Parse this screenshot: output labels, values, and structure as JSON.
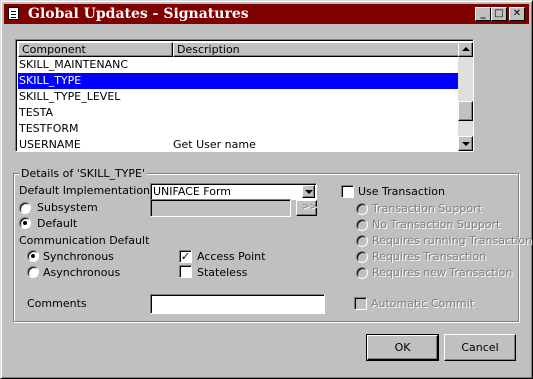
{
  "window": {
    "title": "Global Updates - Signatures",
    "minimize": "_",
    "maximize": "□",
    "close": "✕"
  },
  "list": {
    "columns": [
      "Component",
      "Description"
    ],
    "rows": [
      {
        "component": "SKILL_MAINTENANC",
        "description": ""
      },
      {
        "component": "SKILL_TYPE",
        "description": "",
        "selected": true
      },
      {
        "component": "SKILL_TYPE_LEVEL",
        "description": ""
      },
      {
        "component": "TESTA",
        "description": ""
      },
      {
        "component": "TESTFORM",
        "description": ""
      },
      {
        "component": "USERNAME",
        "description": "Get User name"
      }
    ]
  },
  "details": {
    "group_label": "Details of 'SKILL_TYPE'",
    "default_impl_label": "Default Implementation",
    "default_impl_value": "UNIFACE Form",
    "subsystem_label": "Subsystem",
    "default_label": "Default",
    "browse_label": ">>",
    "comm_default_label": "Communication Default",
    "synchronous_label": "Synchronous",
    "asynchronous_label": "Asynchronous",
    "access_point_label": "Access Point",
    "stateless_label": "Stateless",
    "comments_label": "Comments",
    "comments_value": "",
    "use_transaction_label": "Use Transaction",
    "transaction_support_label": "Transaction Support",
    "no_transaction_support_label": "No Transaction Support",
    "requires_running_label": "Requires running Transaction",
    "requires_transaction_label": "Requires Transaction",
    "requires_new_label": "Requires new Transaction",
    "automatic_commit_label": "Automatic Commit"
  },
  "buttons": {
    "ok": "OK",
    "cancel": "Cancel"
  },
  "colors": {
    "title_bar": "#800000",
    "selection": "#0000ff",
    "face": "#c0c0c0"
  }
}
